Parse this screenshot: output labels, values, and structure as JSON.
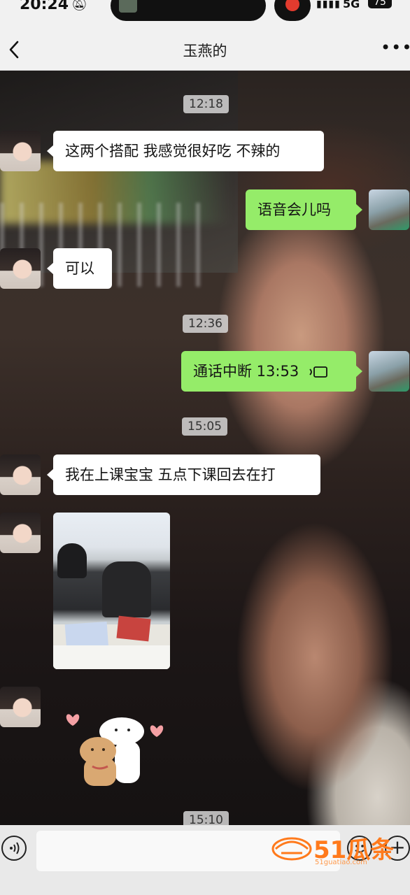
{
  "status_bar": {
    "time": "20:24",
    "network": "5G",
    "battery": "75"
  },
  "nav": {
    "title": "玉燕的"
  },
  "messages": {
    "ts1": "12:18",
    "m1": "这两个搭配 我感觉很好吃 不辣的",
    "m2": "语音会儿吗",
    "m3": "可以",
    "ts2": "12:36",
    "m4_text": "通话中断 13:53",
    "ts3": "15:05",
    "m5": "我在上课宝宝 五点下课回去在打",
    "ts4": "15:10"
  },
  "input": {
    "placeholder": ""
  },
  "watermark": {
    "main": "51瓜条",
    "sub": "51guatiao.com"
  },
  "colors": {
    "outgoing_bubble": "#95ec69",
    "incoming_bubble": "#ffffff",
    "bar": "#f1f1f1"
  }
}
